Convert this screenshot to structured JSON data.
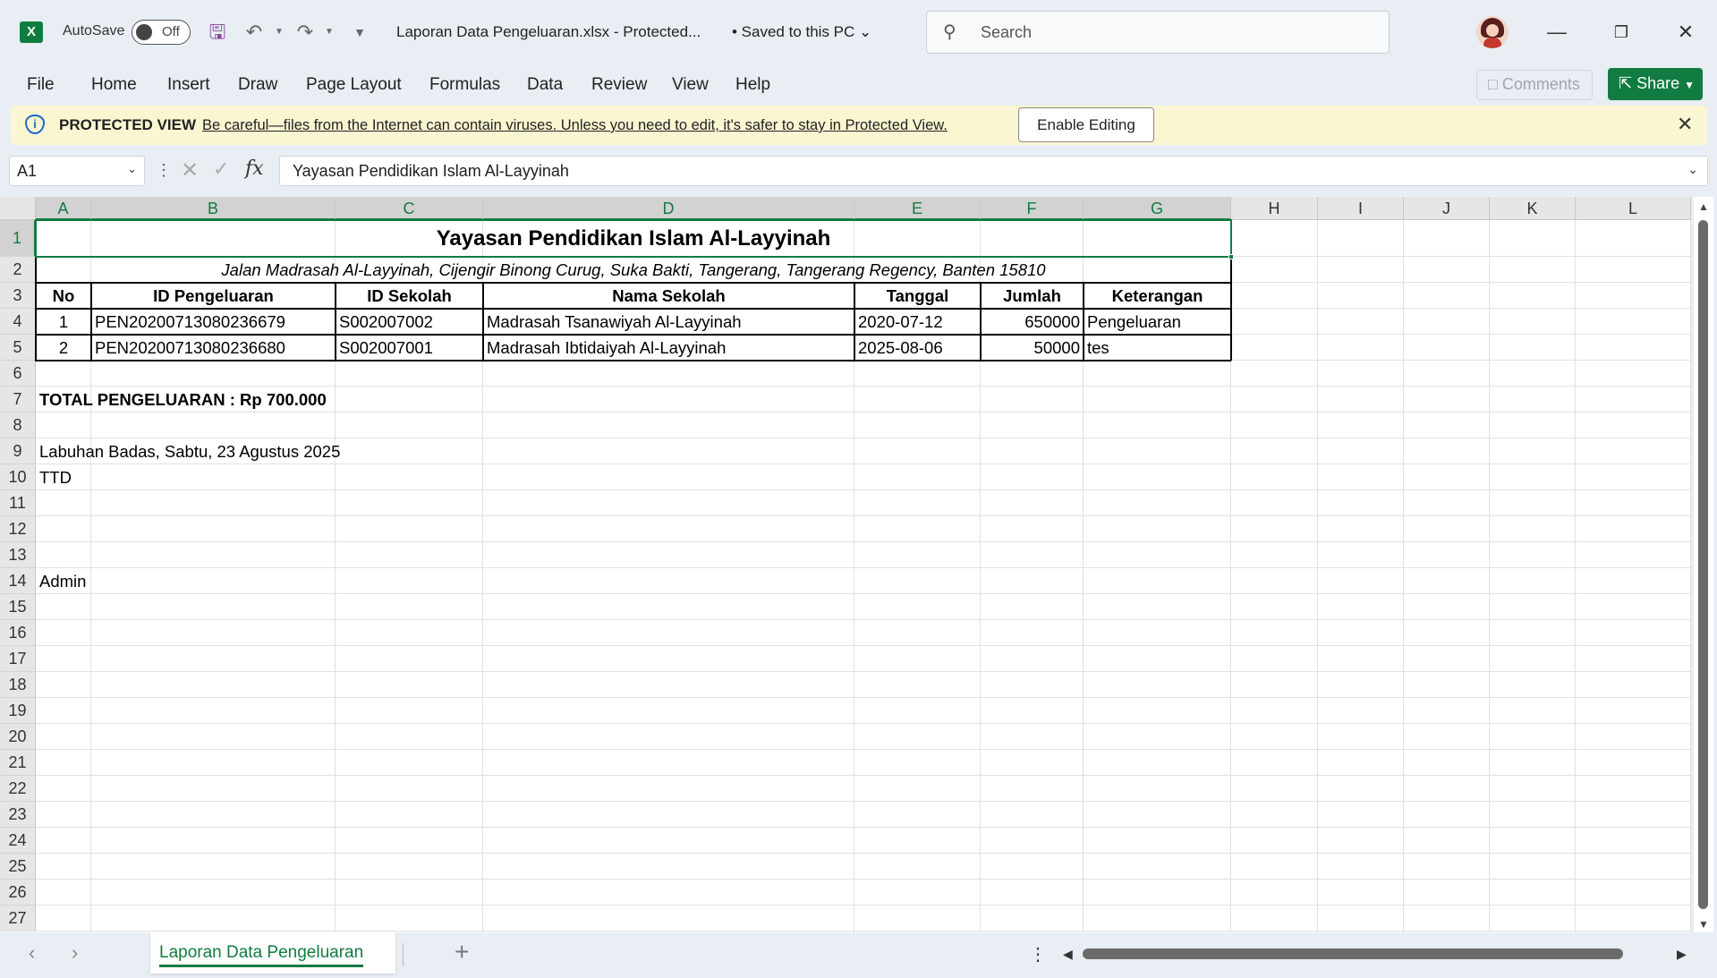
{
  "titlebar": {
    "app_logo": "X",
    "autosave_label": "AutoSave",
    "autosave_state": "Off",
    "doc_title": "Laporan Data Pengeluaran.xlsx  -  Protected...",
    "saved_status": "• Saved to this PC",
    "search_placeholder": "Search"
  },
  "menu": [
    "File",
    "Home",
    "Insert",
    "Draw",
    "Page Layout",
    "Formulas",
    "Data",
    "Review",
    "View",
    "Help"
  ],
  "comments_label": "Comments",
  "share_label": "Share",
  "protected_view": {
    "title": "PROTECTED VIEW",
    "message": "Be careful—files from the Internet can contain viruses. Unless you need to edit, it's safer to stay in Protected View.",
    "enable_button": "Enable Editing"
  },
  "formula_bar": {
    "name_box": "A1",
    "formula": "Yayasan Pendidikan Islam Al-Layyinah"
  },
  "sheet": {
    "columns": [
      "A",
      "B",
      "C",
      "D",
      "E",
      "F",
      "G",
      "H",
      "I",
      "J",
      "K",
      "L"
    ],
    "rows": [
      "1",
      "2",
      "3",
      "4",
      "5",
      "6",
      "7",
      "8",
      "9",
      "10",
      "11",
      "12",
      "13",
      "14",
      "15",
      "16",
      "17",
      "18",
      "19",
      "20",
      "21",
      "22",
      "23",
      "24",
      "25",
      "26",
      "27"
    ],
    "title": "Yayasan Pendidikan Islam Al-Layyinah",
    "address": "Jalan Madrasah Al-Layyinah, Cijengir Binong Curug, Suka Bakti, Tangerang, Tangerang Regency, Banten 15810",
    "headers": [
      "No",
      "ID Pengeluaran",
      "ID Sekolah",
      "Nama Sekolah",
      "Tanggal",
      "Jumlah",
      "Keterangan"
    ],
    "records": [
      [
        "1",
        "PEN20200713080236679",
        "S002007002",
        "Madrasah Tsanawiyah Al-Layyinah",
        "2020-07-12",
        "650000",
        "Pengeluaran"
      ],
      [
        "2",
        "PEN20200713080236680",
        "S002007001",
        "Madrasah Ibtidaiyah Al-Layyinah",
        "2025-08-06",
        "50000",
        "tes"
      ]
    ],
    "total": "TOTAL PENGELUARAN : Rp 700.000",
    "place_date": "Labuhan Badas, Sabtu, 23 Agustus 2025",
    "ttd": "TTD",
    "signer": "Admin"
  },
  "sheet_tab": "Laporan Data Pengeluaran",
  "colors": {
    "accent": "#107c41",
    "banner": "#fbf6d2"
  }
}
